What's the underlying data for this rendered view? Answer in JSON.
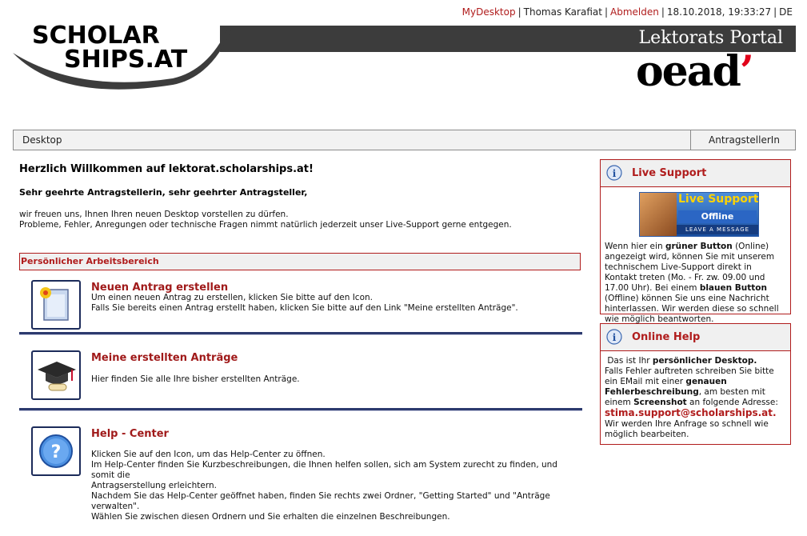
{
  "topbar": {
    "mydesktop": "MyDesktop",
    "user": "Thomas Karafiat",
    "logout": "Abmelden",
    "datetime": "18.10.2018, 19:33:27",
    "lang": "DE",
    "sep": "|"
  },
  "header": {
    "logo_line1": "SCHOLAR",
    "logo_line2": "SHIPS.AT",
    "portal_title": "Lektorats Portal",
    "oead_logo": "oead"
  },
  "nav": {
    "left": "Desktop",
    "right": "AntragstellerIn"
  },
  "main": {
    "welcome": "Herzlich Willkommen auf lektorat.scholarships.at!",
    "greeting": "Sehr geehrte Antragstellerin, sehr geehrter Antragsteller,",
    "intro_line1": "wir freuen uns, Ihnen Ihren neuen Desktop vorstellen zu dürfen.",
    "intro_line2": "Probleme, Fehler, Anregungen oder technische Fragen nimmt natürlich jederzeit unser Live-Support gerne entgegen.",
    "section_title": "Persönlicher Arbeitsbereich",
    "items": [
      {
        "title": "Neuen Antrag erstellen",
        "lines": [
          "Um einen neuen Antrag zu erstellen, klicken Sie bitte auf den Icon.",
          "Falls Sie bereits einen Antrag erstellt haben, klicken Sie bitte auf den Link \"Meine erstellten Anträge\"."
        ],
        "icon": "new-document-icon"
      },
      {
        "title": "Meine erstellten Anträge",
        "lines": [
          "Hier finden Sie alle Ihre bisher erstellten Anträge."
        ],
        "icon": "graduation-cap-icon"
      },
      {
        "title": "Help - Center",
        "lines": [
          "Klicken Sie auf den Icon, um das Help-Center zu öffnen.",
          "Im Help-Center finden Sie Kurzbeschreibungen, die Ihnen helfen sollen, sich am System zurecht zu finden, und somit die",
          "Antragserstellung erleichtern.",
          "Nachdem Sie das Help-Center geöffnet haben, finden Sie rechts zwei Ordner, \"Getting Started\" und \"Anträge verwalten\".",
          "Wählen Sie zwischen diesen Ordnern und Sie erhalten die einzelnen Beschreibungen."
        ],
        "icon": "help-question-icon"
      }
    ]
  },
  "live_support": {
    "title": "Live Support",
    "banner_title": "Live Support!",
    "banner_status": "Offline",
    "banner_msg": "LEAVE A MESSAGE <<<",
    "t1": "Wenn hier ein ",
    "b1": "grüner Button",
    "t2": " (Online) angezeigt wird, können Sie mit unserem technischem Live-Support direkt in Kontakt treten (Mo. - Fr. zw. 09.00 und 17.00 Uhr). Bei einem ",
    "b2": "blauen Button",
    "t3": " (Offline) können Sie uns eine Nachricht hinterlassen. Wir werden diese so schnell wie möglich beantworten."
  },
  "online_help": {
    "title": "Online Help",
    "t1": "Das ist Ihr ",
    "b1": "persönlicher Desktop.",
    "t2": "Falls Fehler auftreten schreiben Sie bitte ein EMail mit einer ",
    "b2": "genauen Fehlerbeschreibung",
    "t3": ", am besten mit einem ",
    "b3": "Screenshot",
    "t4": " an folgende Adresse:",
    "email": "stima.support@scholarships.at.",
    "t5": " Wir werden Ihre Anfrage so schnell wie möglich bearbeiten."
  },
  "colors": {
    "accent_red": "#b01c1c",
    "dark_blue": "#1c2b5a",
    "header_dark": "#3c3c3c"
  }
}
